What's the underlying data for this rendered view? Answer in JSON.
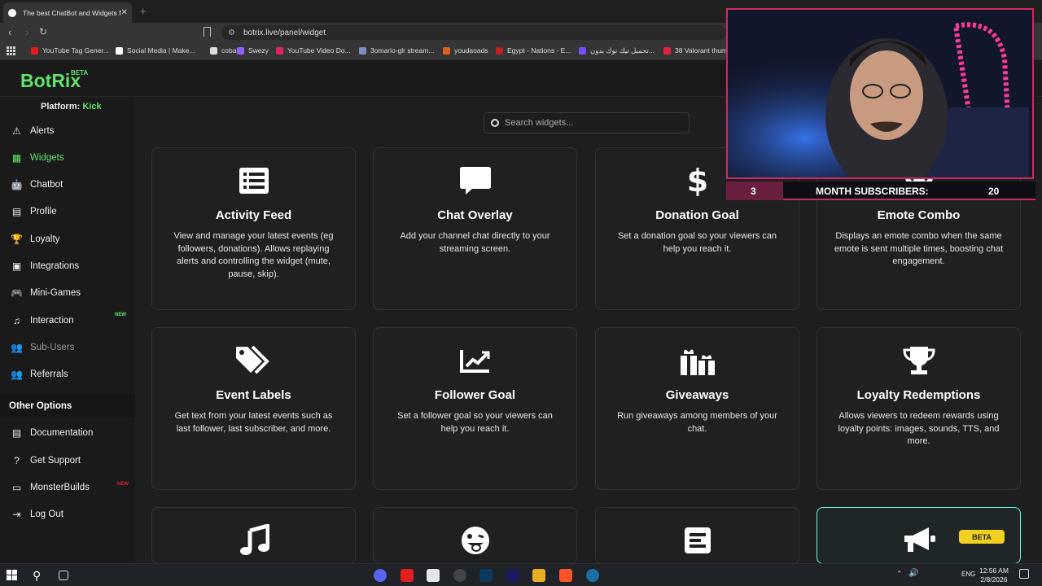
{
  "browser": {
    "tab_title": "The best ChatBot and Widgets f",
    "tab_close": "✕",
    "new_tab": "+",
    "url": "botrix.live/panel/widget",
    "bookmarks": [
      {
        "label": "YouTube Tag Gener...",
        "color": "#e02020"
      },
      {
        "label": "Social Media | Make...",
        "color": "#ffffff"
      },
      {
        "label": "cobalt",
        "color": "#dddddd"
      },
      {
        "label": "Swezy",
        "color": "#8a63ff"
      },
      {
        "label": "YouTube Video Do...",
        "color": "#e02060"
      },
      {
        "label": "3omario-glr stream...",
        "color": "#7a8fbf"
      },
      {
        "label": "youdaoads",
        "color": "#e0601a"
      },
      {
        "label": "Egypt - Nations - E...",
        "color": "#c02020"
      },
      {
        "label": "تحميل تيك توك بدون...",
        "color": "#7a4cff"
      },
      {
        "label": "38 Valorant thumb...",
        "color": "#e02040"
      }
    ]
  },
  "app": {
    "logo": "BotRix",
    "logo_badge": "BETA",
    "platform_label": "Platform:",
    "platform_value": "Kick",
    "nav": [
      {
        "label": "Alerts",
        "icon": "⚠"
      },
      {
        "label": "Widgets",
        "icon": "▦"
      },
      {
        "label": "Chatbot",
        "icon": "🤖"
      },
      {
        "label": "Profile",
        "icon": "▤"
      },
      {
        "label": "Loyalty",
        "icon": "🏆"
      },
      {
        "label": "Integrations",
        "icon": "▣"
      },
      {
        "label": "Mini-Games",
        "icon": "🎮"
      },
      {
        "label": "Interaction",
        "icon": "♫"
      },
      {
        "label": "Sub-Users",
        "icon": "👥"
      },
      {
        "label": "Referrals",
        "icon": "👥"
      }
    ],
    "new_badge": "NEW",
    "other_options_heading": "Other Options",
    "other_nav": [
      {
        "label": "Documentation",
        "icon": "▤"
      },
      {
        "label": "Get Support",
        "icon": "?"
      },
      {
        "label": "MonsterBuilds",
        "icon": "▭"
      },
      {
        "label": "Log Out",
        "icon": "⇥"
      }
    ],
    "search_placeholder": "Search widgets...",
    "cards": [
      {
        "title": "Activity Feed",
        "desc": "View and manage your latest events (eg followers, donations). Allows replaying alerts and controlling the widget (mute, pause, skip).",
        "icon": "list-icon"
      },
      {
        "title": "Chat Overlay",
        "desc": "Add your channel chat directly to your streaming screen.",
        "icon": "message-icon"
      },
      {
        "title": "Donation Goal",
        "desc": "Set a donation goal so your viewers can help you reach it.",
        "icon": "dollar-icon"
      },
      {
        "title": "Emote Combo",
        "desc": "Displays an emote combo when the same emote is sent multiple times, boosting chat engagement.",
        "icon": "crown-icon"
      },
      {
        "title": "Event Labels",
        "desc": "Get text from your latest events such as last follower, last subscriber, and more.",
        "icon": "tags-icon"
      },
      {
        "title": "Follower Goal",
        "desc": "Set a follower goal so your viewers can help you reach it.",
        "icon": "chart-line-icon"
      },
      {
        "title": "Giveaways",
        "desc": "Run giveaways among members of your chat.",
        "icon": "gifts-icon"
      },
      {
        "title": "Loyalty Redemptions",
        "desc": "Allows viewers to redeem rewards using loyalty points: images, sounds, TTS, and more.",
        "icon": "trophy-icon"
      },
      {
        "title": "",
        "desc": "",
        "icon": "music-icon"
      },
      {
        "title": "",
        "desc": "",
        "icon": "tongue-emoji-icon"
      },
      {
        "title": "",
        "desc": "",
        "icon": "text-block-icon"
      },
      {
        "title": "",
        "desc": "",
        "icon": "megaphone-icon",
        "badge": "BETA"
      }
    ]
  },
  "stream_overlay": {
    "left_number": "3",
    "label": "MONTH SUBSCRIBERS:",
    "right_number": "20"
  },
  "taskbar": {
    "time": "12:56 AM",
    "date": "2/8/2026",
    "lang": "ENG"
  }
}
